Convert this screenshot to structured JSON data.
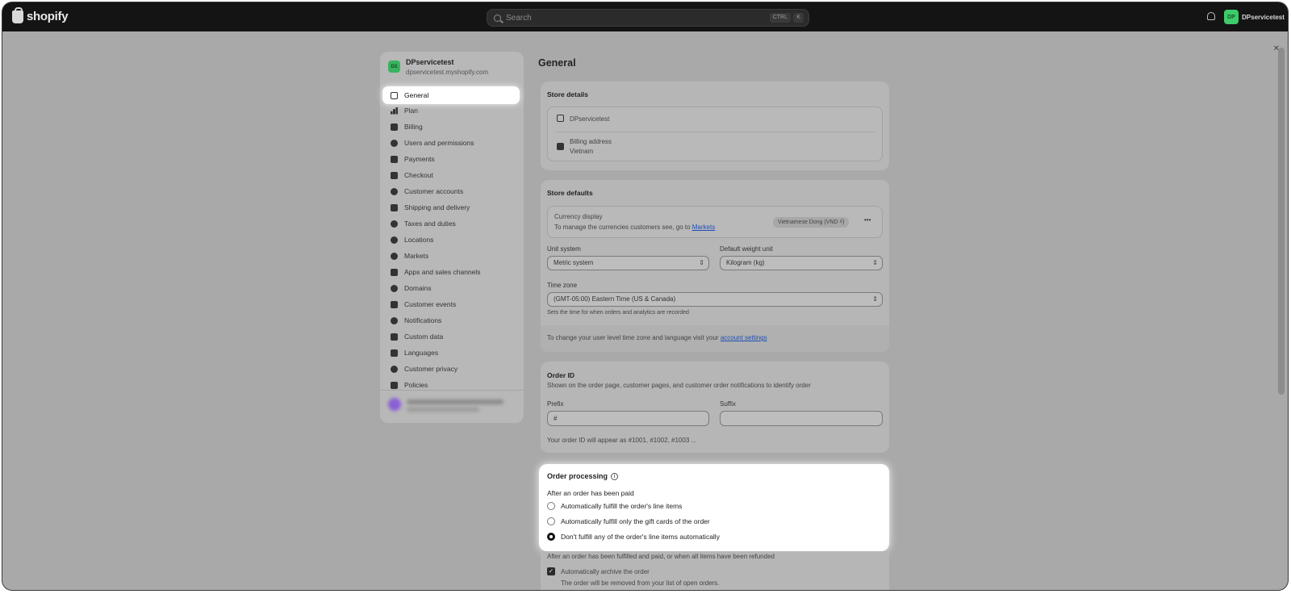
{
  "topbar": {
    "brand": "shopify",
    "search_placeholder": "Search",
    "kbd_ctrl": "CTRL",
    "kbd_k": "K",
    "user_initials": "DP",
    "user_name": "DPservicetest"
  },
  "sidebar": {
    "store_initials": "DS",
    "store_name": "DPservicetest",
    "store_domain": "dpservicetest.myshopify.com",
    "items": [
      {
        "label": "General",
        "active": true
      },
      {
        "label": "Plan"
      },
      {
        "label": "Billing"
      },
      {
        "label": "Users and permissions"
      },
      {
        "label": "Payments"
      },
      {
        "label": "Checkout"
      },
      {
        "label": "Customer accounts"
      },
      {
        "label": "Shipping and delivery"
      },
      {
        "label": "Taxes and duties"
      },
      {
        "label": "Locations"
      },
      {
        "label": "Markets"
      },
      {
        "label": "Apps and sales channels"
      },
      {
        "label": "Domains"
      },
      {
        "label": "Customer events"
      },
      {
        "label": "Notifications"
      },
      {
        "label": "Custom data"
      },
      {
        "label": "Languages"
      },
      {
        "label": "Customer privacy"
      },
      {
        "label": "Policies"
      }
    ]
  },
  "main": {
    "title": "General",
    "store_details": {
      "title": "Store details",
      "store_name": "DPservicetest",
      "billing_label": "Billing address",
      "billing_value": "Vietnam"
    },
    "store_defaults": {
      "title": "Store defaults",
      "currency_label": "Currency display",
      "currency_help_prefix": "To manage the currencies customers see, go to",
      "currency_help_link": "Markets",
      "currency_value": "Vietnamese Dong (VND ₫)",
      "more": "•••",
      "unit_label": "Unit system",
      "unit_value": "Metric system",
      "weight_label": "Default weight unit",
      "weight_value": "Kilogram (kg)",
      "tz_label": "Time zone",
      "tz_value": "(GMT-05:00) Eastern Time (US & Canada)",
      "tz_help": "Sets the time for when orders and analytics are recorded",
      "footer_prefix": "To change your user level time zone and language visit your",
      "footer_link": "account settings"
    },
    "order_id": {
      "title": "Order ID",
      "desc": "Shown on the order page, customer pages, and customer order notifications to identify order",
      "prefix_label": "Prefix",
      "prefix_value": "#",
      "suffix_label": "Suffix",
      "suffix_value": "",
      "example": "Your order ID will appear as #1001, #1002, #1003 ..."
    },
    "order_processing": {
      "title": "Order processing",
      "info": "i",
      "paid_label": "After an order has been paid",
      "options": [
        {
          "label": "Automatically fulfill the order's line items",
          "selected": false
        },
        {
          "label": "Automatically fulfill only the gift cards of the order",
          "selected": false
        },
        {
          "label": "Don't fulfill any of the order's line items automatically",
          "selected": true
        }
      ],
      "fulfilled_label": "After an order has been fulfilled and paid, or when all items have been refunded",
      "archive_label": "Automatically archive the order",
      "archive_help": "The order will be removed from your list of open orders.",
      "check": "✓"
    }
  },
  "close_glyph": "✕"
}
